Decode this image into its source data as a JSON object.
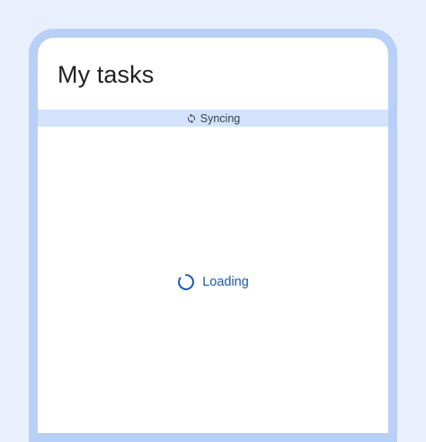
{
  "app": {
    "title": "My tasks"
  },
  "sync_banner": {
    "icon": "sync-icon",
    "label": "Syncing"
  },
  "loading": {
    "icon": "spinner-icon",
    "label": "Loading"
  },
  "colors": {
    "background": "#e9effd",
    "frame": "#b8cff6",
    "banner": "#d3e3fd",
    "accent": "#1a56b8"
  }
}
